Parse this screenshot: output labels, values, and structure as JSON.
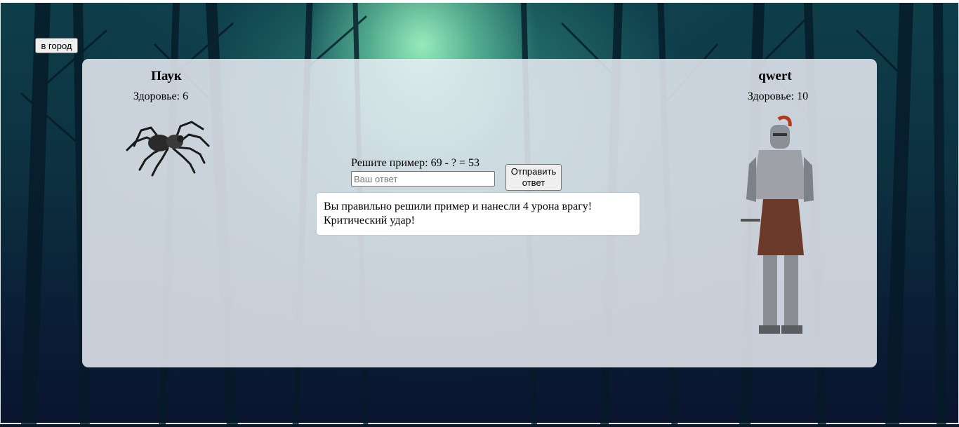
{
  "nav": {
    "city_button": "в город"
  },
  "enemy": {
    "name": "Паук",
    "health_text": "Здоровье: 6",
    "image_icon": "spider-icon"
  },
  "player": {
    "name": "qwert",
    "health_text": "Здоровье: 10",
    "image_icon": "knight-icon"
  },
  "problem": {
    "label": "Решите пример: 69 - ? = 53",
    "placeholder": "Ваш ответ",
    "value": "",
    "submit_line1": "Отправить",
    "submit_line2": "ответ"
  },
  "result": {
    "line1": "Вы правильно решили пример и нанесли 4 урона врагу!",
    "line2": "Критический удар!"
  },
  "colors": {
    "panel": "#e9ecf3",
    "forest_glow": "#aaffc8",
    "forest_dark": "#0a1530"
  }
}
